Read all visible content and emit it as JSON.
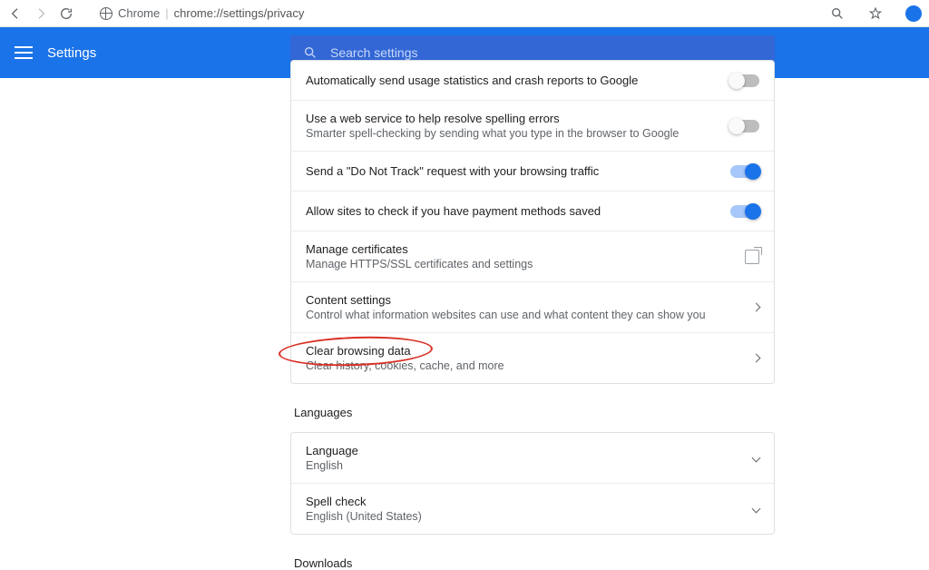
{
  "chrome": {
    "app_label": "Chrome",
    "url": "chrome://settings/privacy"
  },
  "appbar": {
    "title": "Settings",
    "search_placeholder": "Search settings"
  },
  "privacy": {
    "rows": [
      {
        "title": "Automatically send usage statistics and crash reports to Google",
        "sub": "",
        "control": "toggle",
        "on": false
      },
      {
        "title": "Use a web service to help resolve spelling errors",
        "sub": "Smarter spell-checking by sending what you type in the browser to Google",
        "control": "toggle",
        "on": false
      },
      {
        "title": "Send a \"Do Not Track\" request with your browsing traffic",
        "sub": "",
        "control": "toggle",
        "on": true
      },
      {
        "title": "Allow sites to check if you have payment methods saved",
        "sub": "",
        "control": "toggle",
        "on": true
      },
      {
        "title": "Manage certificates",
        "sub": "Manage HTTPS/SSL certificates and settings",
        "control": "external"
      },
      {
        "title": "Content settings",
        "sub": "Control what information websites can use and what content they can show you",
        "control": "caret"
      },
      {
        "title": "Clear browsing data",
        "sub": "Clear history, cookies, cache, and more",
        "control": "caret",
        "annot": true
      }
    ]
  },
  "languages": {
    "heading": "Languages",
    "rows": [
      {
        "title": "Language",
        "sub": "English",
        "control": "caret-down"
      },
      {
        "title": "Spell check",
        "sub": "English (United States)",
        "control": "caret-down"
      }
    ]
  },
  "downloads": {
    "heading": "Downloads"
  }
}
